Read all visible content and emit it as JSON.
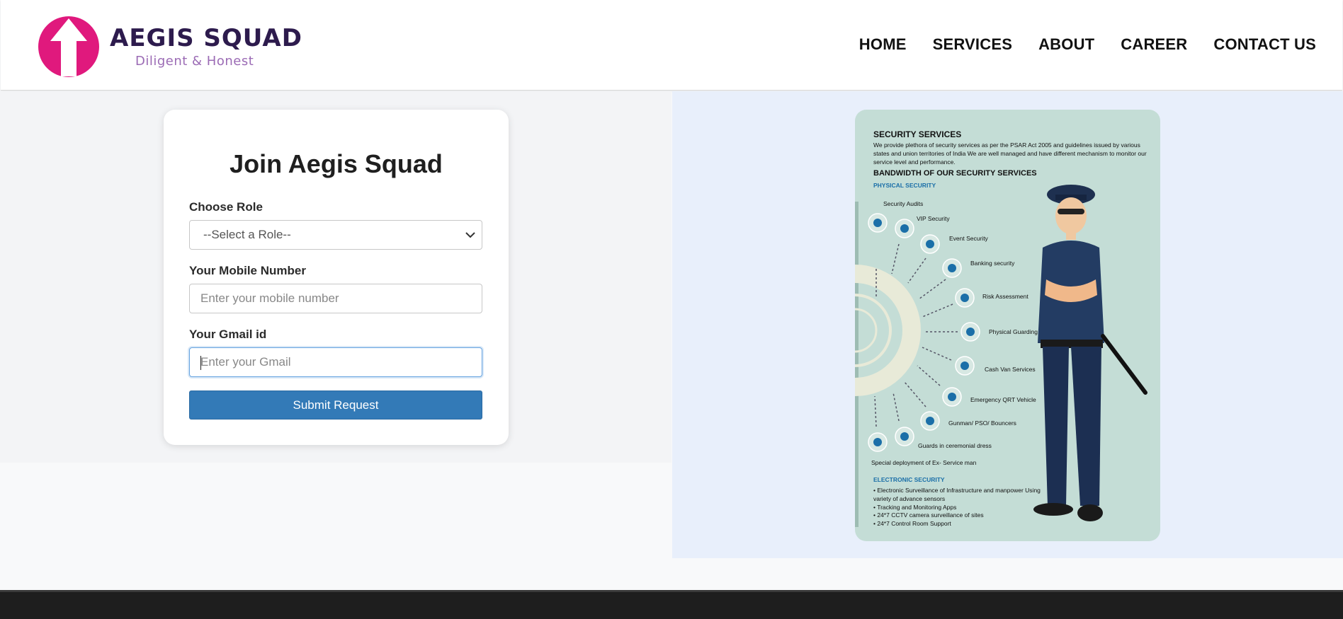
{
  "header": {
    "brand": "AEGIS SQUAD",
    "tagline": "Diligent & Honest",
    "logo_icon": "upward-arrow-circle-icon",
    "nav": [
      "HOME",
      "SERVICES",
      "ABOUT",
      "CAREER",
      "CONTACT US"
    ]
  },
  "form": {
    "title": "Join Aegis Squad",
    "role_label": "Choose Role",
    "role_selected": "--Select a Role--",
    "mobile_label": "Your Mobile Number",
    "mobile_placeholder": "Enter your mobile number",
    "gmail_label": "Your Gmail id",
    "gmail_placeholder": "Enter your Gmail",
    "submit_label": "Submit Request"
  },
  "poster": {
    "title": "SECURITY SERVICES",
    "description": "We provide plethora of security services as per the PSAR Act 2005 and guidelines issued by various states and union territories of India We are well managed and have different mechanism to monitor our service level and performance.",
    "bandwidth_title": "BANDWIDTH OF OUR SECURITY SERVICES",
    "physical_title": "PHYSICAL SECURITY",
    "services": [
      "Security Audits",
      "VIP Security",
      "Event Security",
      "Banking security",
      "Risk Assessment",
      "Physical Guarding",
      "Cash Van Services",
      "Emergency QRT Vehicle",
      "Gunman/ PSO/ Bouncers",
      "Guards in ceremonial dress"
    ],
    "special": "Special deployment of Ex- Service man",
    "electronic_title": "ELECTRONIC SECURITY",
    "electronic_items": [
      "Electronic Surveillance of Infrastructure and manpower Using variety of advance sensors",
      "Tracking and Monitoring Apps",
      "24*7 CCTV camera surveillance of sites",
      "24*7 Control Room Support"
    ]
  },
  "colors": {
    "brand_pink": "#e0197d",
    "brand_dark": "#2d1b4d",
    "tagline_purple": "#9b6bb5",
    "button_blue": "#337ab7",
    "poster_bg": "#c4ddd6",
    "footer": "#1e1e1e"
  }
}
